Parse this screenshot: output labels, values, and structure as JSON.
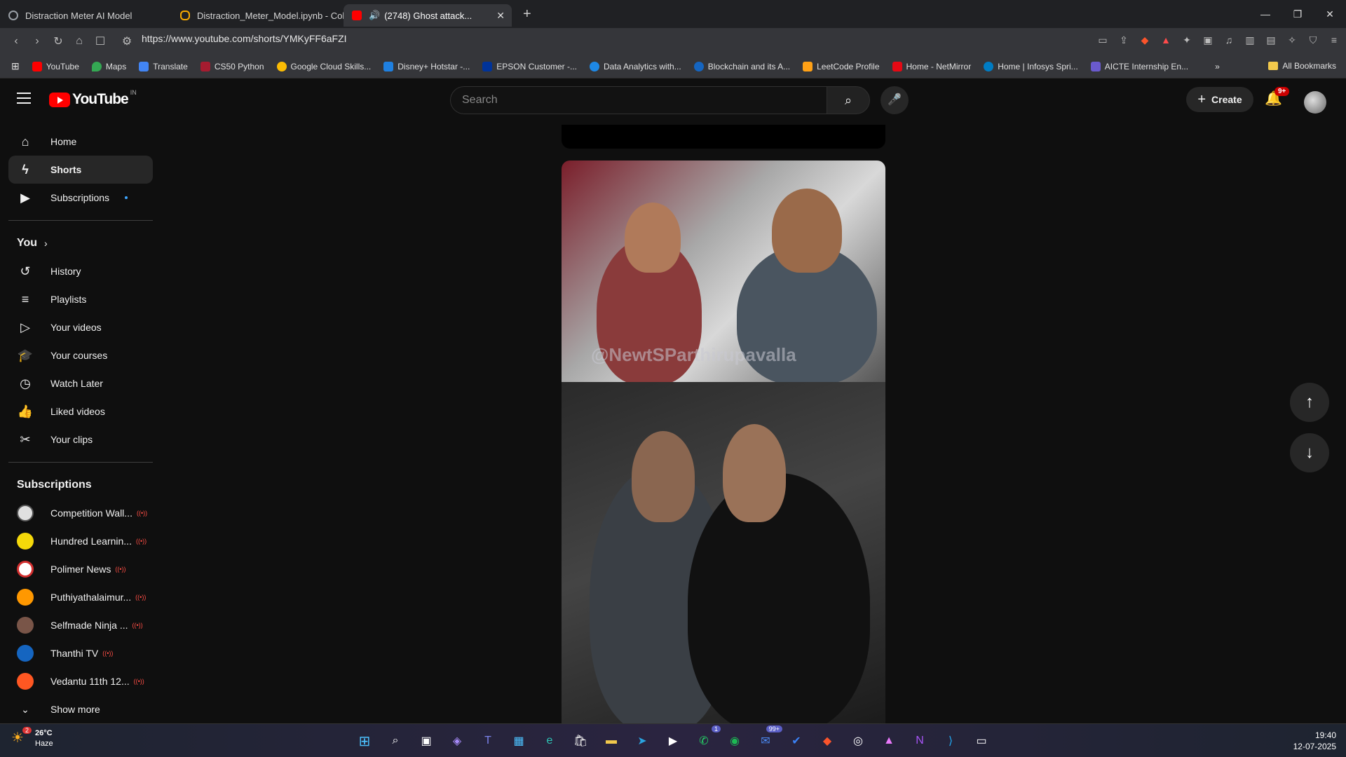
{
  "browser": {
    "tabs": [
      {
        "title": "Distraction Meter AI Model",
        "color": "#9aa0a6"
      },
      {
        "title": "Distraction_Meter_Model.ipynb - Col",
        "color": "#f9ab00"
      },
      {
        "title": "(2748) Ghost attack...",
        "color": "#ff0000",
        "close": "✕"
      }
    ],
    "new_tab": "+",
    "url": "https://www.youtube.com/shorts/YMKyFF6aFZI",
    "bookmarks": [
      {
        "label": "YouTube",
        "color": "#ff0000"
      },
      {
        "label": "Maps",
        "color": "#34a853"
      },
      {
        "label": "Translate",
        "color": "#4285f4"
      },
      {
        "label": "CS50 Python",
        "color": "#a51c30"
      },
      {
        "label": "Google Cloud Skills...",
        "color": "#fbbc04"
      },
      {
        "label": "Disney+ Hotstar -...",
        "color": "#1f80e0"
      },
      {
        "label": "EPSON Customer -...",
        "color": "#003399"
      },
      {
        "label": "Data Analytics with...",
        "color": "#1e88e5"
      },
      {
        "label": "Blockchain and its A...",
        "color": "#1565c0"
      },
      {
        "label": "LeetCode Profile",
        "color": "#ffa116"
      },
      {
        "label": "Home - NetMirror",
        "color": "#e50914"
      },
      {
        "label": "Home | Infosys Spri...",
        "color": "#007cc3"
      },
      {
        "label": "AICTE Internship En...",
        "color": "#6a5acd"
      }
    ],
    "bookmarks_more": "»",
    "all_bookmarks": "All Bookmarks"
  },
  "youtube": {
    "logo_text": "YouTube",
    "country_code": "IN",
    "search_placeholder": "Search",
    "create_label": "Create",
    "notification_count": "9+",
    "sidebar": {
      "primary": [
        {
          "label": "Home",
          "icon": "home-icon"
        },
        {
          "label": "Shorts",
          "icon": "shorts-icon",
          "active": true
        },
        {
          "label": "Subscriptions",
          "icon": "subscriptions-icon"
        }
      ],
      "you_heading": "You",
      "you_items": [
        {
          "label": "History",
          "icon": "history-icon"
        },
        {
          "label": "Playlists",
          "icon": "playlists-icon"
        },
        {
          "label": "Your videos",
          "icon": "your-videos-icon"
        },
        {
          "label": "Your courses",
          "icon": "courses-icon"
        },
        {
          "label": "Watch Later",
          "icon": "watch-later-icon"
        },
        {
          "label": "Liked videos",
          "icon": "like-icon"
        },
        {
          "label": "Your clips",
          "icon": "clips-icon"
        }
      ],
      "subscriptions_heading": "Subscriptions",
      "subscriptions": [
        {
          "label": "Competition Wall...",
          "color": "#e0e0e0"
        },
        {
          "label": "Hundred Learnin...",
          "color": "#f5d90a"
        },
        {
          "label": "Polimer News",
          "color": "#d32f2f"
        },
        {
          "label": "Puthiyathalaimur...",
          "color": "#ff9800"
        },
        {
          "label": "Selfmade Ninja ...",
          "color": "#795548"
        },
        {
          "label": "Thanthi TV",
          "color": "#1565c0"
        },
        {
          "label": "Vedantu 11th 12...",
          "color": "#ff5722"
        }
      ],
      "show_more": "Show more"
    },
    "short": {
      "watermark": "@NewtSParthirupavalla"
    }
  },
  "taskbar": {
    "weather_temp": "26°C",
    "weather_desc": "Haze",
    "weather_badge": "2",
    "whatsapp_badge": "1",
    "mail_badge": "99+",
    "time": "19:40",
    "date": "12-07-2025"
  }
}
